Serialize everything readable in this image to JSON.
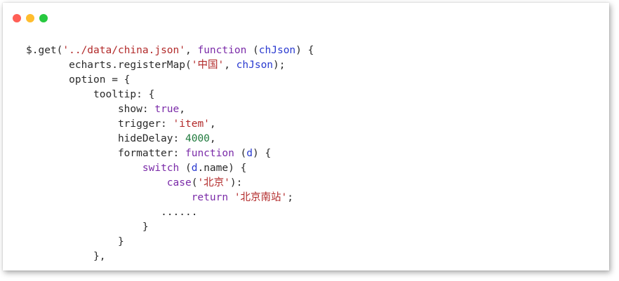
{
  "window": {
    "controls": [
      "close",
      "minimize",
      "maximize"
    ],
    "colors": {
      "close": "#ff5f56",
      "minimize": "#ffbd2e",
      "maximize": "#27c93f"
    }
  },
  "code": {
    "colors": {
      "plain": "#2a2a2a",
      "string": "#b22a2a",
      "keyword": "#7a2aa8",
      "param": "#2a3ad0",
      "number": "#1f7a3d"
    },
    "lines": [
      {
        "indent": 0,
        "tokens": [
          {
            "t": "plain",
            "v": "$.get("
          },
          {
            "t": "string",
            "v": "'../data/china.json'"
          },
          {
            "t": "plain",
            "v": ", "
          },
          {
            "t": "keyword",
            "v": "function"
          },
          {
            "t": "plain",
            "v": " ("
          },
          {
            "t": "param",
            "v": "chJson"
          },
          {
            "t": "plain",
            "v": ") {"
          }
        ]
      },
      {
        "indent": 7,
        "tokens": [
          {
            "t": "plain",
            "v": "echarts.registerMap("
          },
          {
            "t": "string",
            "v": "'中国'"
          },
          {
            "t": "plain",
            "v": ", "
          },
          {
            "t": "param",
            "v": "chJson"
          },
          {
            "t": "plain",
            "v": ");"
          }
        ]
      },
      {
        "indent": 7,
        "tokens": [
          {
            "t": "plain",
            "v": "option = {"
          }
        ]
      },
      {
        "indent": 11,
        "tokens": [
          {
            "t": "plain",
            "v": "tooltip: {"
          }
        ]
      },
      {
        "indent": 15,
        "tokens": [
          {
            "t": "plain",
            "v": "show: "
          },
          {
            "t": "keyword",
            "v": "true"
          },
          {
            "t": "plain",
            "v": ","
          }
        ]
      },
      {
        "indent": 15,
        "tokens": [
          {
            "t": "plain",
            "v": "trigger: "
          },
          {
            "t": "string",
            "v": "'item'"
          },
          {
            "t": "plain",
            "v": ","
          }
        ]
      },
      {
        "indent": 15,
        "tokens": [
          {
            "t": "plain",
            "v": "hideDelay: "
          },
          {
            "t": "number",
            "v": "4000"
          },
          {
            "t": "plain",
            "v": ","
          }
        ]
      },
      {
        "indent": 15,
        "tokens": [
          {
            "t": "plain",
            "v": "formatter: "
          },
          {
            "t": "keyword",
            "v": "function"
          },
          {
            "t": "plain",
            "v": " ("
          },
          {
            "t": "param",
            "v": "d"
          },
          {
            "t": "plain",
            "v": ") {"
          }
        ]
      },
      {
        "indent": 19,
        "tokens": [
          {
            "t": "keyword",
            "v": "switch"
          },
          {
            "t": "plain",
            "v": " ("
          },
          {
            "t": "param",
            "v": "d"
          },
          {
            "t": "plain",
            "v": ".name) {"
          }
        ]
      },
      {
        "indent": 23,
        "tokens": [
          {
            "t": "keyword",
            "v": "case"
          },
          {
            "t": "plain",
            "v": "("
          },
          {
            "t": "string",
            "v": "'北京'"
          },
          {
            "t": "plain",
            "v": "):"
          }
        ]
      },
      {
        "indent": 27,
        "tokens": [
          {
            "t": "keyword",
            "v": "return"
          },
          {
            "t": "plain",
            "v": " "
          },
          {
            "t": "string",
            "v": "'北京南站'"
          },
          {
            "t": "plain",
            "v": ";"
          }
        ]
      },
      {
        "indent": 22,
        "tokens": [
          {
            "t": "plain",
            "v": "......"
          }
        ]
      },
      {
        "indent": 19,
        "tokens": [
          {
            "t": "plain",
            "v": "}"
          }
        ]
      },
      {
        "indent": 15,
        "tokens": [
          {
            "t": "plain",
            "v": "}"
          }
        ]
      },
      {
        "indent": 11,
        "tokens": [
          {
            "t": "plain",
            "v": "},"
          }
        ]
      }
    ]
  }
}
